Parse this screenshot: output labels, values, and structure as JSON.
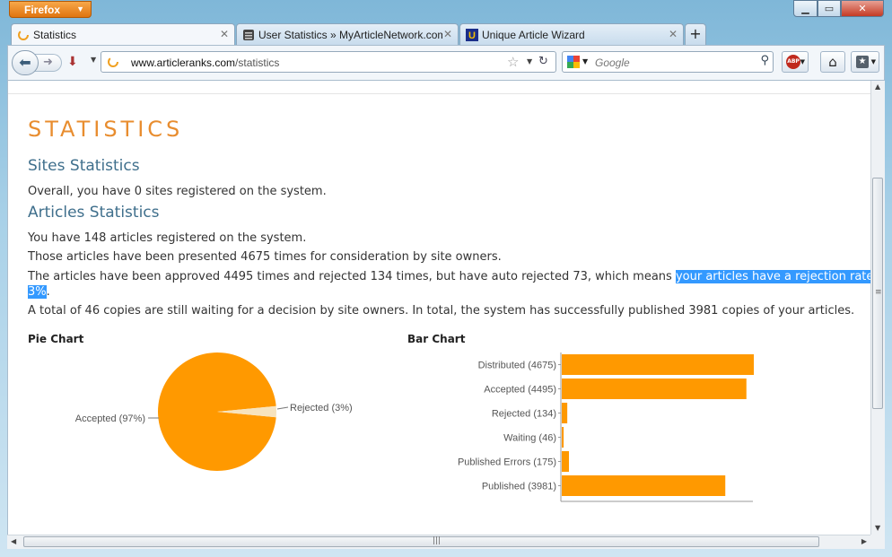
{
  "browser": {
    "menu_label": "Firefox",
    "tabs": [
      {
        "label": "Statistics",
        "active": true
      },
      {
        "label": "User Statistics » MyArticleNetwork.com",
        "active": false
      },
      {
        "label": "Unique Article Wizard",
        "active": false
      }
    ],
    "url_domain": "www.articleranks.com",
    "url_path": "/statistics",
    "search_placeholder": "Google",
    "abp_label": "ABP"
  },
  "page": {
    "title": "STATISTICS",
    "sites_heading": "Sites Statistics",
    "sites_text": "Overall, you have 0 sites registered on the system.",
    "articles_heading": "Articles Statistics",
    "line1": "You have 148 articles registered on the system.",
    "line2": "Those articles have been presented 4675 times for consideration by site owners.",
    "line3_pre": "The articles have been approved 4495 times and rejected 134 times, but have auto rejected 73, which means ",
    "line3_hl1": "your articles have a rejection rate of",
    "line3_hl2": "3%",
    "line3_post": ".",
    "line4": "A total of 46 copies are still waiting for a decision by site owners. In total, the system has successfully published 3981 copies of your articles."
  },
  "chart_data": [
    {
      "type": "pie",
      "title": "Pie Chart",
      "slices": [
        {
          "label": "Accepted (97%)",
          "value": 97,
          "color": "#ff9900"
        },
        {
          "label": "Rejected (3%)",
          "value": 3,
          "color": "#f7e3bd"
        }
      ]
    },
    {
      "type": "bar",
      "orientation": "horizontal",
      "title": "Bar Chart",
      "categories": [
        "Distributed (4675)",
        "Accepted (4495)",
        "Rejected (134)",
        "Waiting (46)",
        "Published Errors (175)",
        "Published (3981)"
      ],
      "values": [
        4675,
        4495,
        134,
        46,
        175,
        3981
      ],
      "color": "#ff9900",
      "xlim": [
        0,
        4675
      ]
    }
  ]
}
